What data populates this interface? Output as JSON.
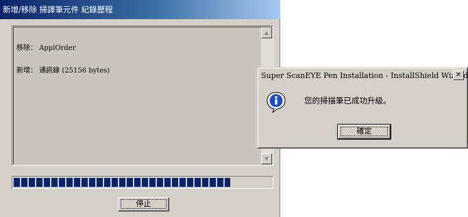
{
  "main_window": {
    "title": "新增/移除 掃譯筆元件 紀錄歷程",
    "log_lines": [
      "移除： ApplOrder",
      "新增： 通訊錄 (25156 bytes)"
    ],
    "progress": 0.84,
    "stop_button_label": "停止"
  },
  "dialog": {
    "title": "Super ScanEYE Pen Installation - InstallShield Wizard",
    "close_label": "✕",
    "message": "您的掃描筆已成功升級。",
    "ok_button_label": "確定",
    "icon": "info-icon"
  },
  "scroll": {
    "up_arrow": "▲",
    "down_arrow": "▼"
  },
  "colors": {
    "title_active_start": "#0a246a",
    "title_active_end": "#a6caf0",
    "progress_block": "#0a246a",
    "info_icon": "#1a4ec8"
  }
}
